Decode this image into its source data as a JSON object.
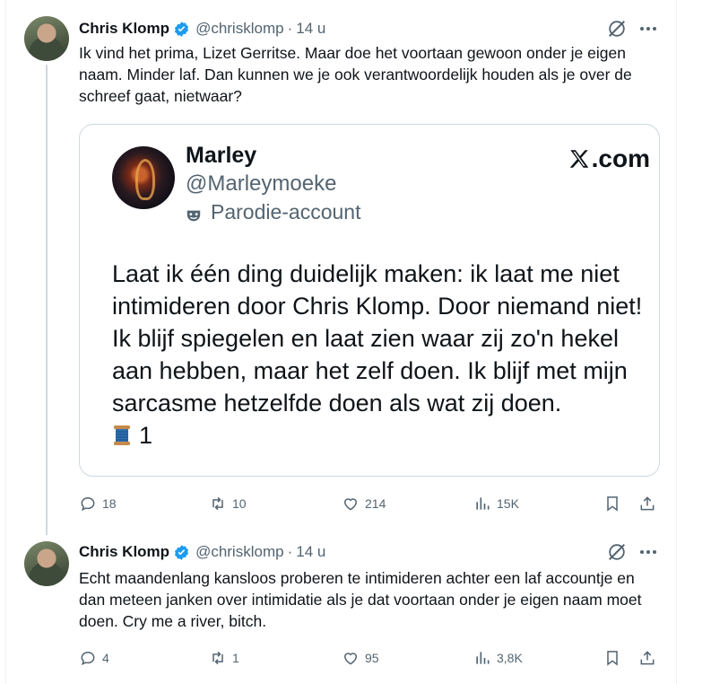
{
  "tweets": [
    {
      "author": "Chris Klomp",
      "handle": "@chrisklomp",
      "separator": "·",
      "time": "14 u",
      "text": "Ik vind het prima, Lizet Gerritse. Maar doe het voortaan gewoon onder je eigen naam. Minder laf. Dan kunnen we je ook verantwoordelijk houden als je over de schreef gaat, nietwaar?",
      "card": {
        "name": "Marley",
        "handle": "@Marleymoeke",
        "label": "Parodie-account",
        "domain": ".com",
        "body": "Laat ik één ding duidelijk maken: ik laat me niet intimideren door Chris Klomp. Door niemand niet! Ik blijf spiegelen en laat zien waar zij zo'n hekel aan hebben, maar het zelf doen. Ik blijf met mijn sarcasme hetzelfde doen als wat zij doen.",
        "spool_count": "1"
      },
      "stats": {
        "replies": "18",
        "reposts": "10",
        "likes": "214",
        "views": "15K"
      }
    },
    {
      "author": "Chris Klomp",
      "handle": "@chrisklomp",
      "separator": "·",
      "time": "14 u",
      "text": "Echt maandenlang kansloos proberen te intimideren achter een laf accountje en dan meteen janken over intimidatie als je dat voortaan onder je eigen naam moet doen. Cry me a river, bitch.",
      "stats": {
        "replies": "4",
        "reposts": "1",
        "likes": "95",
        "views": "3,8K"
      }
    }
  ],
  "colors": {
    "text": "#0f1419",
    "secondary": "#536471",
    "verified": "#1d9bf0",
    "border": "#cfd9de"
  },
  "icons": [
    "verified-badge-icon",
    "grok-icon",
    "more-icon",
    "reply-icon",
    "repost-icon",
    "like-icon",
    "views-icon",
    "bookmark-icon",
    "share-icon",
    "x-logo-icon",
    "parody-mask-icon",
    "spool-icon"
  ]
}
